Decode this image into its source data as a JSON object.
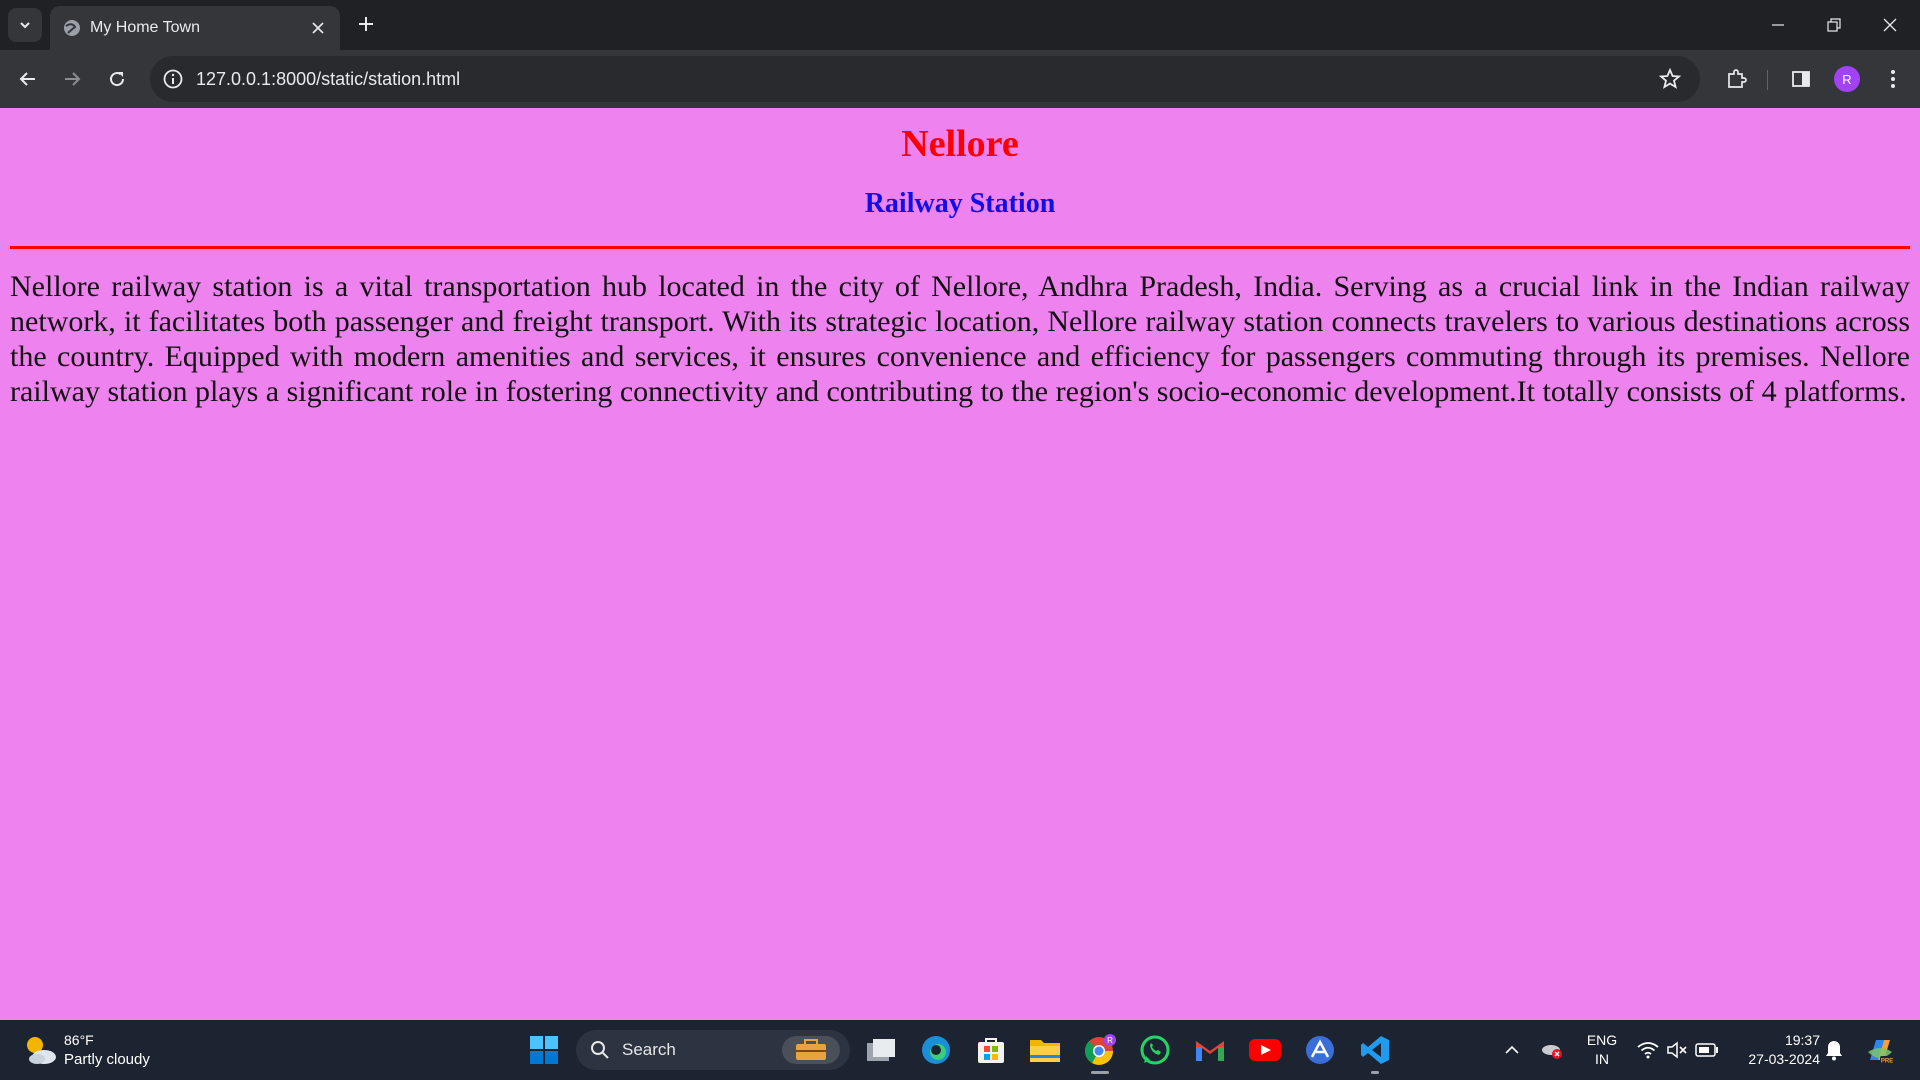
{
  "browser": {
    "tab_title": "My Home Town",
    "url": "127.0.0.1:8000/static/station.html",
    "profile_initial": "R"
  },
  "page": {
    "title": "Nellore",
    "subtitle": "Railway Station",
    "body": "Nellore railway station is a vital transportation hub located in the city of Nellore, Andhra Pradesh, India. Serving as a crucial link in the Indian railway network, it facilitates both passenger and freight transport. With its strategic location, Nellore railway station connects travelers to various destinations across the country. Equipped with modern amenities and services, it ensures convenience and efficiency for passengers commuting through its premises. Nellore railway station plays a significant role in fostering connectivity and contributing to the region's socio-economic development.It totally consists of 4 platforms.",
    "background_color": "#ee82ee",
    "title_color": "#ff0000",
    "subtitle_color": "#1010e6"
  },
  "taskbar": {
    "weather_temp": "86°F",
    "weather_desc": "Partly cloudy",
    "search_label": "Search",
    "language": "ENG",
    "region": "IN",
    "time": "19:37",
    "date": "27-03-2024",
    "apps": [
      "windows-start",
      "search",
      "task-view",
      "edge",
      "microsoft-store",
      "file-explorer",
      "chrome",
      "whatsapp",
      "gmail",
      "youtube",
      "arc-app",
      "vs-code"
    ]
  }
}
